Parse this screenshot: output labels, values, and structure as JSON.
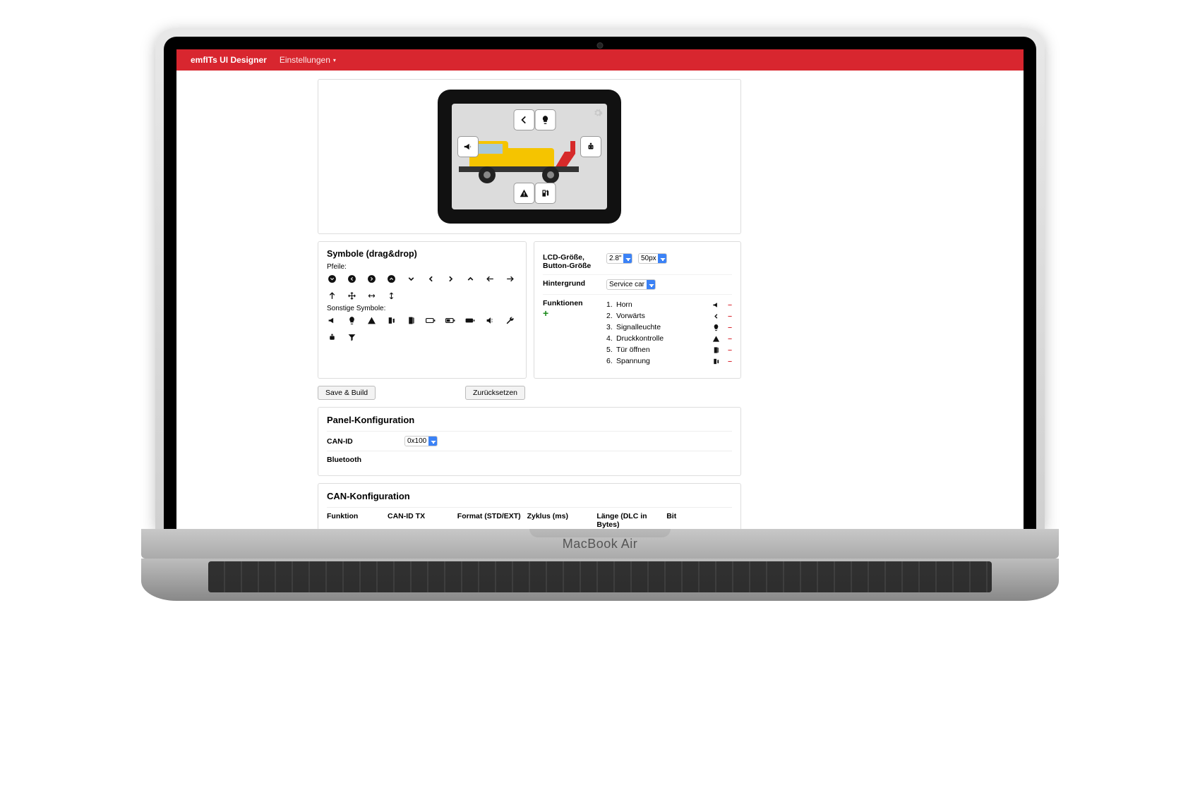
{
  "device_mockup_label": "MacBook Air",
  "navbar": {
    "brand": "emfITs UI Designer",
    "menu": "Einstellungen"
  },
  "preview": {
    "gear_icon": "gear",
    "slot_icons": [
      "chevron-left",
      "bulb",
      "horn",
      "warn",
      "door",
      "pump"
    ]
  },
  "settings": {
    "lcd_label": "LCD-Größe, Button-Größe",
    "lcd_size": "2.8\"",
    "btn_size": "50px",
    "bg_label": "Hintergrund",
    "bg_value": "Service car",
    "func_label": "Funktionen",
    "functions": [
      {
        "n": "1.",
        "t": "Horn",
        "icon": "horn"
      },
      {
        "n": "2.",
        "t": "Vorwärts",
        "icon": "chevron-left"
      },
      {
        "n": "3.",
        "t": "Signalleuchte",
        "icon": "bulb"
      },
      {
        "n": "4.",
        "t": "Druckkontrolle",
        "icon": "warn"
      },
      {
        "n": "5.",
        "t": "Tür öffnen",
        "icon": "door"
      },
      {
        "n": "6.",
        "t": "Spannung",
        "icon": "pump"
      }
    ]
  },
  "actions": {
    "save": "Save & Build",
    "reset": "Zurücksetzen"
  },
  "symbols": {
    "title": "Symbole (drag&drop)",
    "sec1": "Pfeile:",
    "arrows": [
      "circle-down",
      "circle-left",
      "circle-right",
      "circle-up",
      "v-down",
      "v-left",
      "v-right",
      "v-up",
      "arr-left",
      "arr-right",
      "arr-up",
      "move",
      "arr-h",
      "arr-v"
    ],
    "sec2": "Sonstige Symbole:",
    "other": [
      "horn",
      "bulb",
      "warn",
      "pump",
      "door",
      "batt1",
      "batt2",
      "batt3",
      "sound",
      "wrench",
      "robot",
      "funnel"
    ]
  },
  "panel": {
    "title": "Panel-Konfiguration",
    "canid_label": "CAN-ID",
    "canid_value": "0x100",
    "bt_label": "Bluetooth"
  },
  "canconf": {
    "title": "CAN-Konfiguration",
    "cols": [
      "Funktion",
      "CAN-ID TX",
      "Format (STD/EXT)",
      "Zyklus (ms)",
      "Länge (DLC in Bytes)",
      "Bit"
    ]
  }
}
